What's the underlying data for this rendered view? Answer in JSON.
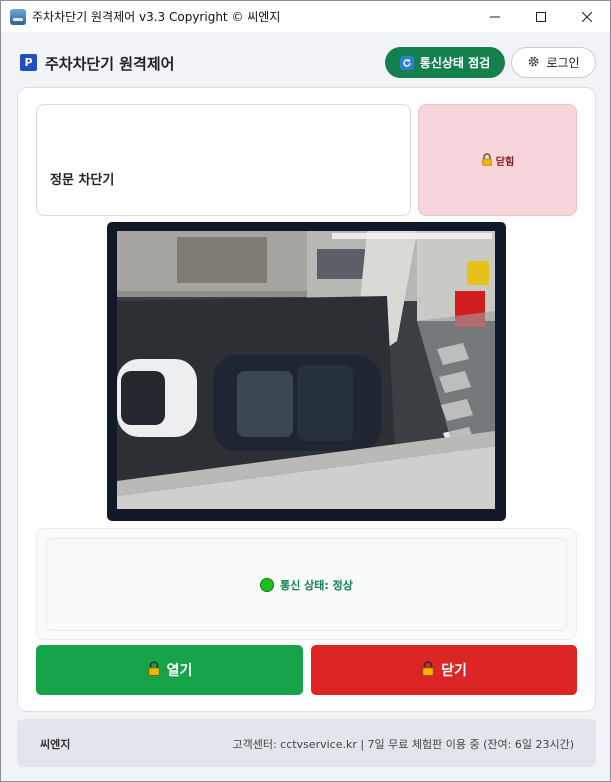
{
  "window": {
    "title": "주차차단기 원격제어 v3.3 Copyright © 씨엔지",
    "controls": {
      "minimize": "minimize",
      "maximize": "maximize",
      "close": "close"
    }
  },
  "header": {
    "badge": "P",
    "title": "주차차단기 원격제어",
    "comm_check_label": "통신상태 점검",
    "login_label": "로그인"
  },
  "gate": {
    "name": "정문 차단기",
    "state_label": "닫힘"
  },
  "camera": {
    "description_icon": "camera-feed"
  },
  "status": {
    "text": "통신 상태: 정상"
  },
  "actions": {
    "open_label": "열기",
    "close_label": "닫기"
  },
  "footer": {
    "brand": "씨엔지",
    "info": "고객센터: cctvservice.kr  |  7일 무료 체험판 이용 중 (잔여: 6일 23시간)"
  },
  "colors": {
    "comm_button": "#13804e",
    "state_box": "#f6d6da",
    "open_button": "#16a34a",
    "close_button": "#dc2626",
    "status_ok": "#1ec01e"
  }
}
